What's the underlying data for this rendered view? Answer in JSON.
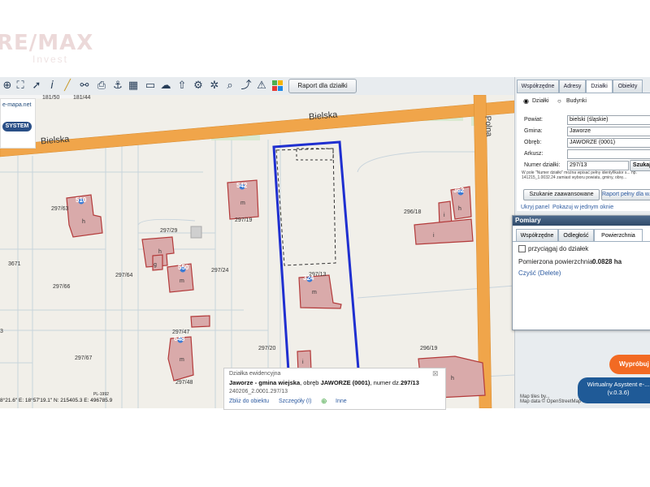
{
  "watermark": {
    "line1": "RE/MAX",
    "line2": "Invest"
  },
  "toolbar": {
    "icons": [
      "zoom-in-icon",
      "fullscreen-icon",
      "select-icon",
      "info-icon",
      "measure-icon",
      "link-icon",
      "print-icon",
      "anchor-icon",
      "layers-icon",
      "comment-icon",
      "cloud-icon",
      "settings-icon",
      "search-icon",
      "share-icon",
      "warning-icon",
      "legend-icon"
    ],
    "report_label": "Raport dla działki"
  },
  "logo": {
    "url": "e-mapa.net",
    "brand": "SYSTEM"
  },
  "map": {
    "streets": {
      "bielska_left": "Bielska",
      "bielska_right": "Bielska",
      "polna": "Polna"
    },
    "parcels": [
      "181/50",
      "181/44",
      "297/63",
      "297/29",
      "297/19",
      "296/18",
      "3671",
      "297/64",
      "297/24",
      "297/13",
      "297/66",
      "297/67",
      "297/48",
      "297/20",
      "296/19",
      "296/7",
      "297/47"
    ],
    "parcel_extra": {
      "left_edge": "3",
      "right_edge": "20"
    },
    "building_numbers": [
      "510",
      "542",
      "550",
      "362",
      "324",
      "648"
    ],
    "building_letters": [
      "h",
      "m",
      "h",
      "g",
      "m",
      "m",
      "m",
      "i",
      "h",
      "i",
      "m",
      "m",
      "h",
      "i"
    ]
  },
  "panel": {
    "tabs": [
      "Współrzędne",
      "Adresy",
      "Działki",
      "Obiekty"
    ],
    "active_tab": "Działki",
    "radio": {
      "dzialki": "Działki",
      "budynki": "Budynki",
      "selected": "Działki"
    },
    "fields": {
      "powiat_label": "Powiat:",
      "powiat_value": "bielski (śląskie)",
      "gmina_label": "Gmina:",
      "gmina_value": "Jaworze",
      "obreb_label": "Obręb:",
      "obreb_value": "JAWORZE (0001)",
      "arkusz_label": "Arkusz:",
      "arkusz_value": "",
      "numer_label": "Numer działki:",
      "numer_value": "297/13"
    },
    "search_button": "Szukaj",
    "hint": "W pole \"Numer działki\" można wpisać pełny identyfikator s... np. 141215_1.0032.24 zamiast wyboru powiatu, gminy, obrę...",
    "advanced_button": "Szukanie zaawansowane",
    "full_report_button": "Raport pełny dla w...",
    "hide_panel": "Ukryj panel",
    "show_window": "Pokazuj w jednym oknie"
  },
  "pomiary": {
    "title": "Pomiary",
    "tabs": [
      "Współrzędne",
      "Odległość",
      "Powierzchnia"
    ],
    "active_tab": "Powierzchnia",
    "snap_label": "przyciągaj do działek",
    "area_label": "Pomierzona powierzchnia:",
    "area_value": "0.0828 ha",
    "clear_link": "Czyść (Delete)"
  },
  "popup": {
    "title": "Działka ewidencyjna",
    "place": "Jaworze - gmina wiejska",
    "obreb_prefix": ", obręb ",
    "obreb": "JAWORZE (0001)",
    "number_prefix": ", numer dz.",
    "number": "297/13",
    "id": "240206_2.0001.297/13",
    "links": [
      "Zbliż do obiektu",
      "Szczegóły (I)",
      "Inne"
    ]
  },
  "status": {
    "coords": "8°21.6\"  E: 18°57'19.1\"  N: 215405.3  E: 496785.9",
    "crs": "PL-1992"
  },
  "attribution": {
    "line1": "Map tiles by...",
    "line2": "Map data © OpenStreetMap contr..."
  },
  "cta": {
    "wyprobuj": "Wypróbuj",
    "va_line1": "Wirtualny Asystent e-...",
    "va_line2": "(v.0.3.6)"
  },
  "colors": {
    "road": "#f0a54a",
    "building_fill": "#d9aaaa",
    "building_stroke": "#b33a3a",
    "selection": "#1f2fd0",
    "panel_header": "#2f4a6a"
  }
}
